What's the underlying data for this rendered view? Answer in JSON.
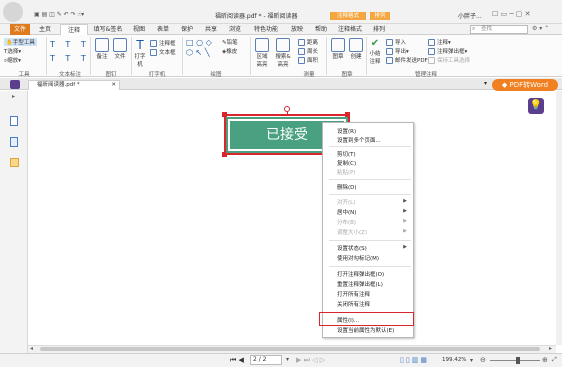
{
  "window": {
    "title": "福昕阅读器.pdf * - 福昕阅读器",
    "contextual_tab_annotation_format": "注释格式",
    "contextual_tab_arrange": "排列",
    "user": "小胖子...",
    "search_placeholder": "查找"
  },
  "ribbon_tabs": [
    {
      "label": "文件"
    },
    {
      "label": "主页"
    },
    {
      "label": "注释"
    },
    {
      "label": "填写&签名"
    },
    {
      "label": "视图"
    },
    {
      "label": "表单"
    },
    {
      "label": "保护"
    },
    {
      "label": "共享"
    },
    {
      "label": "浏览"
    },
    {
      "label": "特色功能"
    },
    {
      "label": "放映"
    },
    {
      "label": "帮助"
    },
    {
      "label": "注释格式"
    },
    {
      "label": "排列"
    }
  ],
  "ribbon": {
    "tools": {
      "hand": "手型工具",
      "select": "选择",
      "zoom": "缩放",
      "group": "工具"
    },
    "text_markup": {
      "group": "文本标注"
    },
    "pin": {
      "note": "备注",
      "file": "文件",
      "group": "图钉"
    },
    "typewriter": {
      "label": "打字机",
      "callout": "注释框",
      "textbox": "文本框",
      "group": "打字机"
    },
    "drawing": {
      "pencil": "铅笔",
      "eraser": "橡皮",
      "group": "绘图"
    },
    "area": {
      "area_highlight": "区域高亮",
      "search_highlight": "搜索&高亮"
    },
    "measure": {
      "distance": "距离",
      "perimeter": "周长",
      "area": "面积",
      "group": "测量"
    },
    "stamp": {
      "stamp": "图章",
      "create": "创建",
      "group": "图章"
    },
    "manage": {
      "summarize": "小结注释",
      "import": "导入",
      "export": "导出",
      "email_pdf": "邮件发送PDF",
      "annot_panel": "注释",
      "annot_popup": "注释弹出框",
      "keep_tool": "保持工具选择",
      "group": "管理注释"
    }
  },
  "doc_tab": {
    "label": "福昕阅读器.pdf *"
  },
  "pdf_to_word": "PDF转Word",
  "stamp_text": "已接受",
  "context_menu": [
    {
      "label": "设置(R)",
      "disabled": false,
      "submenu": false
    },
    {
      "label": "设置到多个页面...",
      "disabled": false,
      "submenu": false
    },
    {
      "label": "剪切(T)",
      "disabled": false,
      "submenu": false
    },
    {
      "label": "复制(C)",
      "disabled": false,
      "submenu": false
    },
    {
      "label": "粘贴(P)",
      "disabled": true,
      "submenu": false
    },
    {
      "label": "删除(D)",
      "disabled": false,
      "submenu": false
    },
    {
      "label": "对齐(L)",
      "disabled": true,
      "submenu": true
    },
    {
      "label": "居中(N)",
      "disabled": false,
      "submenu": true
    },
    {
      "label": "分布(B)",
      "disabled": true,
      "submenu": true
    },
    {
      "label": "调整大小(Z)",
      "disabled": true,
      "submenu": true
    },
    {
      "label": "设置状态(S)",
      "disabled": false,
      "submenu": true
    },
    {
      "label": "使用对勾标记(M)",
      "disabled": false,
      "submenu": false
    },
    {
      "label": "打开注释弹出框(O)",
      "disabled": false,
      "submenu": false
    },
    {
      "label": "重置注释弹出框(L)",
      "disabled": false,
      "submenu": false
    },
    {
      "label": "打开所有注释",
      "disabled": false,
      "submenu": false
    },
    {
      "label": "关闭所有注释",
      "disabled": false,
      "submenu": false
    },
    {
      "label": "属性(I)...",
      "disabled": false,
      "submenu": false
    },
    {
      "label": "设置当前属性为默认(E)",
      "disabled": false,
      "submenu": false
    }
  ],
  "status": {
    "page_value": "2 / 2",
    "zoom": "199.42%"
  }
}
